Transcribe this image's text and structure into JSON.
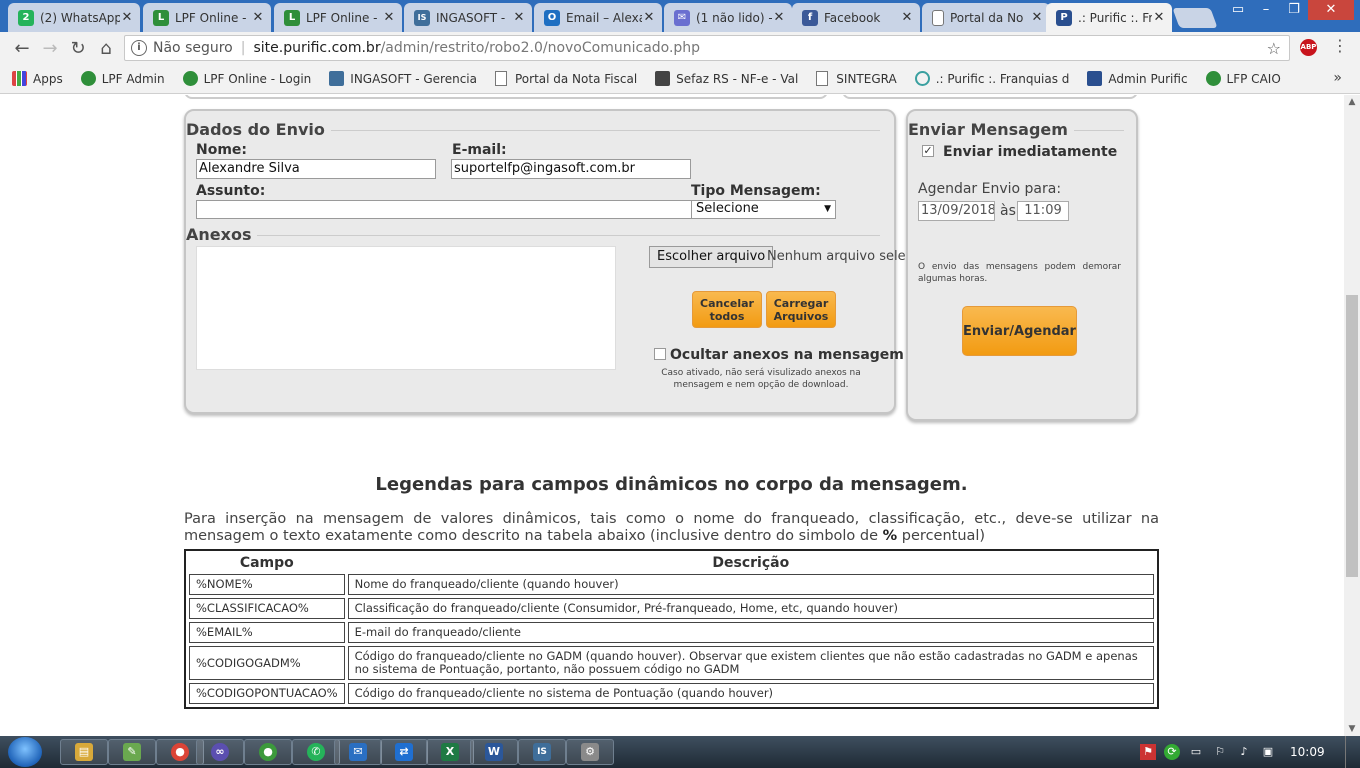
{
  "browser": {
    "tabs": [
      {
        "label": "(2) WhatsApp",
        "icon_color": "#25b35a",
        "icon_text": "2"
      },
      {
        "label": "LPF Online - ",
        "icon_color": "#2f8f3a",
        "icon_text": "L"
      },
      {
        "label": "LPF Online - ",
        "icon_color": "#2f8f3a",
        "icon_text": "L"
      },
      {
        "label": "INGASOFT - ",
        "icon_color": "#3f6e9a",
        "icon_text": "IS"
      },
      {
        "label": "Email – Alexa",
        "icon_color": "#1e6fc2",
        "icon_text": "O"
      },
      {
        "label": "(1 não lido) - ",
        "icon_color": "#6a6fd0",
        "icon_text": "✉"
      },
      {
        "label": "Facebook",
        "icon_color": "#3b5998",
        "icon_text": "f"
      },
      {
        "label": "Portal da No",
        "icon_color": "#ffffff",
        "icon_text": ""
      },
      {
        "label": ".: Purific :. Fra",
        "icon_color": "#2a4f8f",
        "icon_text": "P"
      }
    ],
    "address": {
      "security_label": "Não seguro",
      "domain": "site.purific.com.br",
      "path": "/admin/restrito/robo2.0/novoComunicado.php"
    },
    "bookmarks": [
      {
        "label": "Apps",
        "icon": "apps-grid-icon"
      },
      {
        "label": "LPF Admin",
        "icon": "lpf-icon"
      },
      {
        "label": "LPF Online - Login",
        "icon": "lpf-icon"
      },
      {
        "label": "INGASOFT - Gerencia",
        "icon": "ingasoft-icon"
      },
      {
        "label": "Portal da Nota Fiscal",
        "icon": "document-icon"
      },
      {
        "label": "Sefaz RS - NF-e - Val",
        "icon": "sefaz-icon"
      },
      {
        "label": "SINTEGRA",
        "icon": "document-icon"
      },
      {
        "label": ".: Purific :. Franquias d",
        "icon": "purific-icon"
      },
      {
        "label": "Admin Purific",
        "icon": "purific-p-icon"
      },
      {
        "label": "LFP CAIO",
        "icon": "lpf-icon"
      }
    ]
  },
  "form": {
    "dados_title": "Dados do Envio",
    "nome_label": "Nome:",
    "nome_value": "Alexandre Silva",
    "email_label": "E-mail:",
    "email_value": "suportelfp@ingasoft.com.br",
    "assunto_label": "Assunto:",
    "assunto_value": "",
    "tipo_label": "Tipo Mensagem:",
    "tipo_value": "Selecione",
    "anexos_title": "Anexos",
    "file_button": "Escolher arquivo",
    "file_status": "Nenhum arquivo selecionado",
    "cancelar_line1": "Cancelar",
    "cancelar_line2": "todos",
    "carregar_line1": "Carregar",
    "carregar_line2": "Arquivos",
    "ocultar_label": "Ocultar anexos na mensagem",
    "ocultar_help_1": "Caso ativado, não será visulizado anexos na",
    "ocultar_help_2": "mensagem e nem opção de download."
  },
  "send": {
    "title": "Enviar Mensagem",
    "imediato_label": "Enviar imediatamente",
    "imediato_checked": true,
    "agendar_label": "Agendar Envio para:",
    "date_value": "13/09/2018",
    "as_label": "às",
    "time_value": "11:09",
    "note": "O envio das mensagens podem demorar algumas horas.",
    "button": "Enviar/Agendar"
  },
  "legend": {
    "heading": "Legendas para campos dinâmicos no corpo da mensagem.",
    "para_before": "Para inserção na mensagem de valores dinâmicos, tais como o nome do franqueado, classificação, etc., deve-se utilizar na mensagem o texto exatamente como descrito na tabela abaixo (inclusive dentro do simbolo de ",
    "para_symbol": "%",
    "para_after": " percentual)",
    "col_campo": "Campo",
    "col_descricao": "Descrição",
    "rows": [
      {
        "campo": "%NOME%",
        "descricao": "Nome do franqueado/cliente (quando houver)"
      },
      {
        "campo": "%CLASSIFICACAO%",
        "descricao": "Classificação do franqueado/cliente (Consumidor, Pré-franqueado, Home, etc, quando houver)"
      },
      {
        "campo": "%EMAIL%",
        "descricao": "E-mail do franqueado/cliente"
      },
      {
        "campo": "%CODIGOGADM%",
        "descricao": "Código do franqueado/cliente no GADM (quando houver). Observar que existem clientes que não estão cadastradas no GADM e apenas no sistema de Pontuação, portanto, não possuem código no GADM"
      },
      {
        "campo": "%CODIGOPONTUACAO%",
        "descricao": "Código do franqueado/cliente no sistema de Pontuação (quando houver)"
      }
    ]
  },
  "taskbar": {
    "apps": [
      {
        "name": "explorer",
        "color": "#d8a93a",
        "text": "▤"
      },
      {
        "name": "paint",
        "color": "#6aa84f",
        "text": "✎"
      },
      {
        "name": "chrome",
        "color": "#db4437",
        "text": "●"
      },
      {
        "name": "app-spiral",
        "color": "#5b4fb0",
        "text": "∞"
      },
      {
        "name": "app-green",
        "color": "#3c9a3c",
        "text": "●"
      },
      {
        "name": "whatsapp",
        "color": "#25b35a",
        "text": "✆"
      },
      {
        "name": "outlook-mail",
        "color": "#2a6fc2",
        "text": "✉"
      },
      {
        "name": "teamviewer",
        "color": "#1f6fd1",
        "text": "⇄"
      },
      {
        "name": "excel",
        "color": "#1f7a44",
        "text": "X"
      },
      {
        "name": "word",
        "color": "#2b579a",
        "text": "W"
      },
      {
        "name": "ingasoft",
        "color": "#3f6e9a",
        "text": "IS"
      },
      {
        "name": "remote",
        "color": "#8a8a8a",
        "text": "⚙"
      }
    ],
    "clock": "10:09"
  }
}
